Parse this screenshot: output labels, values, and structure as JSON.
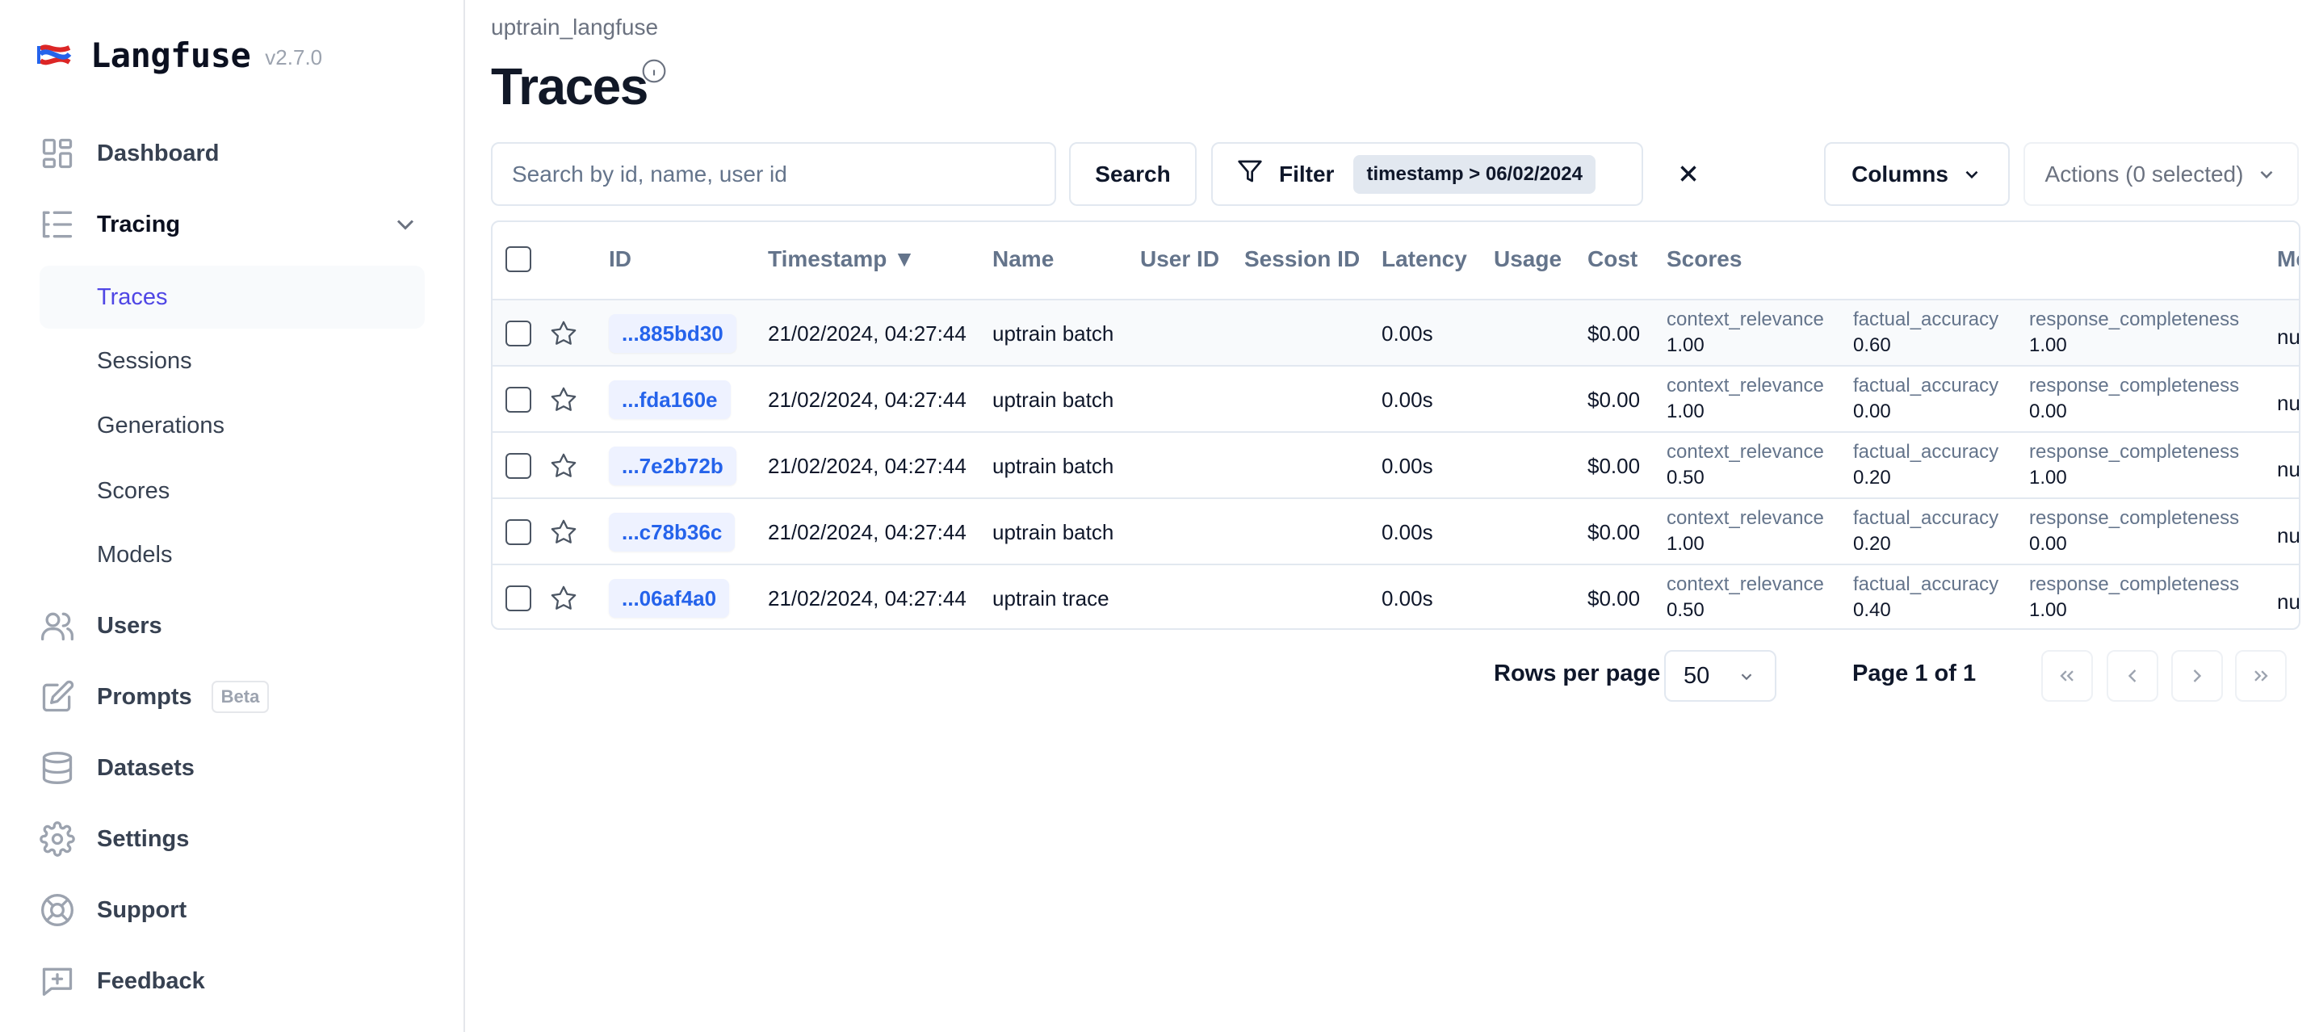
{
  "app": {
    "name": "Langfuse",
    "version": "v2.7.0"
  },
  "sidebar": {
    "items": [
      {
        "label": "Dashboard",
        "icon": "dashboard-icon"
      },
      {
        "label": "Tracing",
        "icon": "tracing-icon",
        "expanded": true
      },
      {
        "label": "Users",
        "icon": "users-icon"
      },
      {
        "label": "Prompts",
        "icon": "prompts-icon",
        "badge": "Beta"
      },
      {
        "label": "Datasets",
        "icon": "database-icon"
      },
      {
        "label": "Settings",
        "icon": "gear-icon"
      },
      {
        "label": "Support",
        "icon": "lifebuoy-icon"
      },
      {
        "label": "Feedback",
        "icon": "feedback-icon"
      }
    ],
    "tracing_sub": [
      {
        "label": "Traces",
        "active": true
      },
      {
        "label": "Sessions"
      },
      {
        "label": "Generations"
      },
      {
        "label": "Scores"
      },
      {
        "label": "Models"
      }
    ]
  },
  "header": {
    "breadcrumb": "uptrain_langfuse",
    "title": "Traces"
  },
  "toolbar": {
    "search_placeholder": "Search by id, name, user id",
    "search_value": "",
    "search_label": "Search",
    "filter_label": "Filter",
    "filter_chip": "timestamp > 06/02/2024",
    "columns_label": "Columns",
    "actions_label": "Actions (0 selected)"
  },
  "table": {
    "columns": [
      "ID",
      "Timestamp ▼",
      "Name",
      "User ID",
      "Session ID",
      "Latency",
      "Usage",
      "Cost",
      "Scores",
      "Me"
    ],
    "rows": [
      {
        "id": "...885bd30",
        "timestamp": "21/02/2024, 04:27:44",
        "name": "uptrain batch",
        "user_id": "",
        "session_id": "",
        "latency": "0.00s",
        "usage": "",
        "cost": "$0.00",
        "scores": [
          {
            "name": "context_relevance",
            "value": "1.00"
          },
          {
            "name": "factual_accuracy",
            "value": "0.60"
          },
          {
            "name": "response_completeness",
            "value": "1.00"
          }
        ],
        "metadata": "nu"
      },
      {
        "id": "...fda160e",
        "timestamp": "21/02/2024, 04:27:44",
        "name": "uptrain batch",
        "user_id": "",
        "session_id": "",
        "latency": "0.00s",
        "usage": "",
        "cost": "$0.00",
        "scores": [
          {
            "name": "context_relevance",
            "value": "1.00"
          },
          {
            "name": "factual_accuracy",
            "value": "0.00"
          },
          {
            "name": "response_completeness",
            "value": "0.00"
          }
        ],
        "metadata": "nu"
      },
      {
        "id": "...7e2b72b",
        "timestamp": "21/02/2024, 04:27:44",
        "name": "uptrain batch",
        "user_id": "",
        "session_id": "",
        "latency": "0.00s",
        "usage": "",
        "cost": "$0.00",
        "scores": [
          {
            "name": "context_relevance",
            "value": "0.50"
          },
          {
            "name": "factual_accuracy",
            "value": "0.20"
          },
          {
            "name": "response_completeness",
            "value": "1.00"
          }
        ],
        "metadata": "nu"
      },
      {
        "id": "...c78b36c",
        "timestamp": "21/02/2024, 04:27:44",
        "name": "uptrain batch",
        "user_id": "",
        "session_id": "",
        "latency": "0.00s",
        "usage": "",
        "cost": "$0.00",
        "scores": [
          {
            "name": "context_relevance",
            "value": "1.00"
          },
          {
            "name": "factual_accuracy",
            "value": "0.20"
          },
          {
            "name": "response_completeness",
            "value": "0.00"
          }
        ],
        "metadata": "nu"
      },
      {
        "id": "...06af4a0",
        "timestamp": "21/02/2024, 04:27:44",
        "name": "uptrain trace",
        "user_id": "",
        "session_id": "",
        "latency": "0.00s",
        "usage": "",
        "cost": "$0.00",
        "scores": [
          {
            "name": "context_relevance",
            "value": "0.50"
          },
          {
            "name": "factual_accuracy",
            "value": "0.40"
          },
          {
            "name": "response_completeness",
            "value": "1.00"
          }
        ],
        "metadata": "nu"
      }
    ]
  },
  "pagination": {
    "rows_per_page_label": "Rows per page",
    "rows_per_page": "50",
    "page_label": "Page 1 of 1"
  },
  "colors": {
    "accent": "#4f46e5",
    "link": "#2563eb",
    "id_badge_bg": "#eef2ff"
  }
}
